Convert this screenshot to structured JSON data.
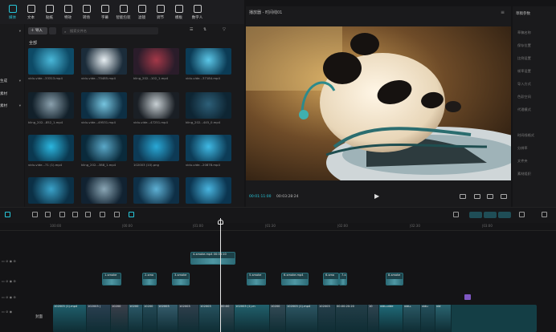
{
  "toolbar": {
    "items": [
      "媒体",
      "文本",
      "贴纸",
      "特效",
      "转场",
      "字幕",
      "智能包装",
      "滤镜",
      "调节",
      "模板",
      "数字人"
    ]
  },
  "sidebar": {
    "items": [
      "",
      "",
      "生成",
      "素材",
      "素材",
      "素材"
    ]
  },
  "media": {
    "import_label": "导入",
    "search_placeholder": "搜索文件名",
    "all_label": "全部",
    "items": [
      {
        "name": "vidu-vide...33313.mp4"
      },
      {
        "name": "vidu-vide...75485.mp4"
      },
      {
        "name": "kling_202...102_1.mp4"
      },
      {
        "name": "vidu-vide...37184.mp4"
      },
      {
        "name": "kling_202...852_1.mp4"
      },
      {
        "name": "vidu-vide...49531.mp4"
      },
      {
        "name": "vidu-vide...47251.mp4"
      },
      {
        "name": "kling_202...445_0.mp4"
      },
      {
        "name": "vidu-vide...71 (1).mp4"
      },
      {
        "name": "kling_202...388_1.mp4"
      },
      {
        "name": "102003 (10).png"
      },
      {
        "name": "vidu-vide...20878.mp4"
      },
      {
        "name": ""
      },
      {
        "name": ""
      },
      {
        "name": ""
      },
      {
        "name": ""
      }
    ]
  },
  "player": {
    "title": "播放器 - 时间线01",
    "current_time": "00:01:11:00",
    "total_time": "00:03:28:24"
  },
  "props": {
    "title": "草稿参数",
    "rows": [
      "草稿名称",
      "保存位置",
      "比例设置",
      "帧率设置",
      "导入方式",
      "色彩空间",
      "代理模式",
      "",
      "时间线格式",
      "分辨率",
      "文件夹",
      "素材组织"
    ]
  },
  "timeline": {
    "ruler": [
      "100:00",
      "|00:00",
      "|01:00",
      "|01:30",
      "|02:00",
      "|02:30",
      "|03:00"
    ],
    "cover_label": "封面",
    "track_labels": [
      "",
      "",
      "",
      ""
    ],
    "clips_top": [
      {
        "label": "4-smoke.mp4",
        "time": "00:00:10"
      }
    ],
    "clips_mid": [
      {
        "label": "1-smoke"
      },
      {
        "label": "2-smo"
      },
      {
        "label": "3-smoke"
      },
      {
        "label": "5-smoke"
      },
      {
        "label": "6-smoke.mp4"
      },
      {
        "label": "6-smo"
      },
      {
        "label": "7-s"
      },
      {
        "label": "8-smoke"
      }
    ],
    "main_segments": [
      "102003 (1).mp4",
      "102003 (",
      "10200",
      "10200",
      "10200",
      "102003",
      "102003",
      "102003",
      "00:00",
      "102003 (1).m",
      "10200",
      "102003 (1).mp4",
      "102003",
      "00:00:20:20",
      "10",
      "vidu-vide",
      "vidu-",
      "vidu",
      "vid"
    ]
  }
}
